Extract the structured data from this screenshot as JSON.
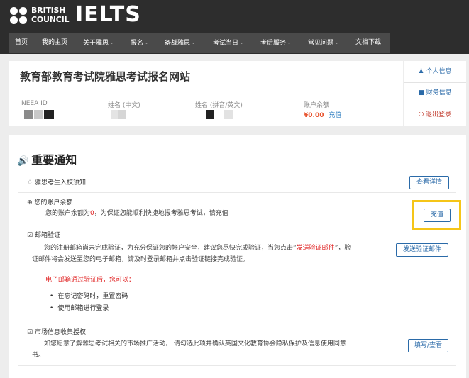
{
  "header": {
    "brand_line1": "BRITISH",
    "brand_line2": "COUNCIL",
    "product": "IELTS",
    "nav": [
      {
        "label": "首页",
        "has_caret": false
      },
      {
        "label": "我的主页",
        "has_caret": false
      },
      {
        "label": "关于雅思",
        "has_caret": true
      },
      {
        "label": "报名",
        "has_caret": true
      },
      {
        "label": "备战雅思",
        "has_caret": true
      },
      {
        "label": "考试当日",
        "has_caret": true
      },
      {
        "label": "考后服务",
        "has_caret": true
      },
      {
        "label": "常见问题",
        "has_caret": true
      },
      {
        "label": "文档下载",
        "has_caret": false
      }
    ]
  },
  "profile": {
    "site_title": "教育部教育考试院雅思考试报名网站",
    "neea_id_label": "NEEA ID",
    "name_cn_label": "姓名 (中文)",
    "name_en_label": "姓名 (拼音/英文)",
    "balance_label": "账户余额",
    "balance_amount": "¥0.00",
    "recharge_link": "充值"
  },
  "side_menu": {
    "personal_info": "个人信息",
    "finance_info": "财务信息",
    "logout": "退出登录"
  },
  "notices": {
    "title": "重要通知",
    "entry_notice": {
      "heading": "雅思考生入校须知",
      "button": "查看详情"
    },
    "balance": {
      "heading": "您的账户余额",
      "text_before": "您的账户余额为",
      "amount": "0",
      "text_after": "，为保证您能顺利快捷地报考雅思考试，请充值",
      "button": "充值"
    },
    "email": {
      "heading": "邮箱验证",
      "line1_before": "您的注册邮箱尚未完成验证，为充分保证您的帐户安全，建议您尽快完成验证，当您点击“",
      "line1_link": "发送验证邮件",
      "line1_after": "”，验",
      "line2": "证邮件将会发送至您的电子邮箱，请及时登录邮箱并点击验证链接完成验证。",
      "after_verify": "电子邮箱通过验证后，您可以：",
      "bullets": [
        "在忘记密码时，重置密码",
        "使用邮箱进行登录"
      ],
      "button": "发送验证邮件"
    },
    "marketing": {
      "heading": "市场信息收集授权",
      "line1": "如您愿意了解雅思考试相关的市场推广活动， 请勾选此项并确认英国文化教育协会隐私保护及信息使用同意",
      "line2": "书。",
      "button": "填写/查看"
    }
  },
  "colors": {
    "header_bg": "#2d2d2d",
    "nav_bg": "#4a4a4a",
    "link_blue": "#2a6aa8",
    "balance_orange": "#e8542f",
    "alert_red": "#e02020",
    "highlight_yellow": "#f5c518"
  }
}
